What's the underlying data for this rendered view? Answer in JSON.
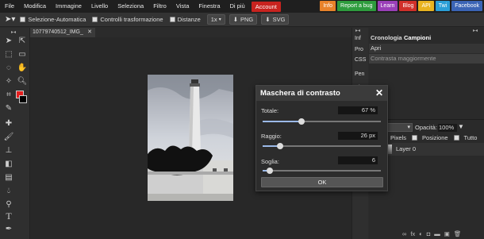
{
  "menubar": {
    "items": [
      "File",
      "Modifica",
      "Immagine",
      "Livello",
      "Seleziona",
      "Filtro",
      "Vista",
      "Finestra",
      "Di più"
    ],
    "account_label": "Account",
    "ext_links": [
      {
        "label": "Info",
        "color": "#e8822a"
      },
      {
        "label": "Report a bug",
        "color": "#2e9c3d"
      },
      {
        "label": "Learn",
        "color": "#9a3fb8"
      },
      {
        "label": "Blog",
        "color": "#d0302a"
      },
      {
        "label": "API",
        "color": "#e9b320"
      },
      {
        "label": "Twi",
        "color": "#2a9fd8"
      },
      {
        "label": "Facebook",
        "color": "#3b64b5"
      }
    ]
  },
  "optbar": {
    "auto_select": "Selezione-Automatica",
    "transform_controls": "Controlli trasformazione",
    "distances": "Distanze",
    "zoom": "1x",
    "png": "PNG",
    "svg": "SVG"
  },
  "document": {
    "tab_title": "10779740512_IMG_"
  },
  "rightcol": {
    "tabs": [
      "Inf",
      "Pro",
      "CSS",
      "Pen",
      "Ch"
    ]
  },
  "history": {
    "tabs": [
      "Cronologia",
      "Campioni"
    ],
    "items": [
      "Apri",
      "Contrasta maggiormente"
    ]
  },
  "layers": {
    "blend_mode": "al",
    "opacity_label": "Opacità:",
    "opacity_value": "100%",
    "lock_options": [
      "Pixels",
      "Posizione",
      "Tutto"
    ],
    "layer_name": "Layer 0"
  },
  "dialog": {
    "title": "Maschera di contrasto",
    "fields": [
      {
        "label": "Totale:",
        "value": "67 %",
        "fraction": 0.33
      },
      {
        "label": "Raggio:",
        "value": "26 px",
        "fraction": 0.15
      },
      {
        "label": "Soglia:",
        "value": "6",
        "fraction": 0.06
      }
    ],
    "ok_label": "OK"
  }
}
